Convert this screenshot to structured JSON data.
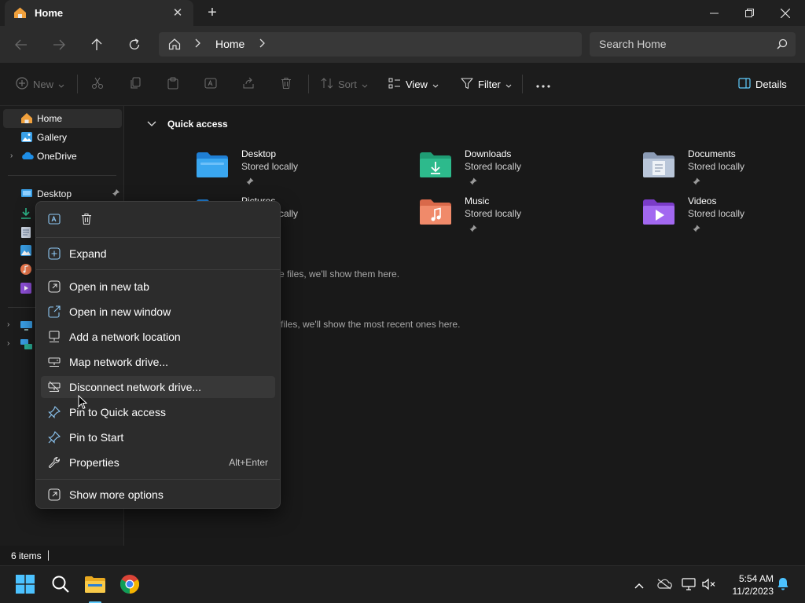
{
  "tab": {
    "title": "Home"
  },
  "address": {
    "crumb": "Home"
  },
  "search": {
    "placeholder": "Search Home"
  },
  "toolbar": {
    "new_label": "New",
    "sort_label": "Sort",
    "view_label": "View",
    "filter_label": "Filter",
    "details_label": "Details"
  },
  "sidebar": {
    "home": "Home",
    "gallery": "Gallery",
    "onedrive": "OneDrive",
    "desktop": "Desktop"
  },
  "main": {
    "section_title": "Quick access",
    "items": [
      {
        "name": "Desktop",
        "sub": "Stored locally"
      },
      {
        "name": "Downloads",
        "sub": "Stored locally"
      },
      {
        "name": "Documents",
        "sub": "Stored locally"
      },
      {
        "name": "Pictures",
        "sub": "Stored locally"
      },
      {
        "name": "Music",
        "sub": "Stored locally"
      },
      {
        "name": "Videos",
        "sub": "Stored locally"
      }
    ],
    "empty_favorites": "e files, we'll show them here.",
    "empty_recent": "files, we'll show the most recent ones here."
  },
  "context_menu": {
    "items": [
      {
        "label": "Expand"
      },
      {
        "label": "Open in new tab"
      },
      {
        "label": "Open in new window"
      },
      {
        "label": "Add a network location"
      },
      {
        "label": "Map network drive..."
      },
      {
        "label": "Disconnect network drive..."
      },
      {
        "label": "Pin to Quick access"
      },
      {
        "label": "Pin to Start"
      },
      {
        "label": "Properties",
        "shortcut": "Alt+Enter"
      },
      {
        "label": "Show more options"
      }
    ]
  },
  "status": {
    "count": "6 items"
  },
  "clock": {
    "time": "5:54 AM",
    "date": "11/2/2023"
  },
  "colors": {
    "accent": "#60cdff",
    "folder_blue": "#3aa0e8",
    "folder_green": "#2dba8c",
    "folder_yellow": "#f6c344"
  }
}
